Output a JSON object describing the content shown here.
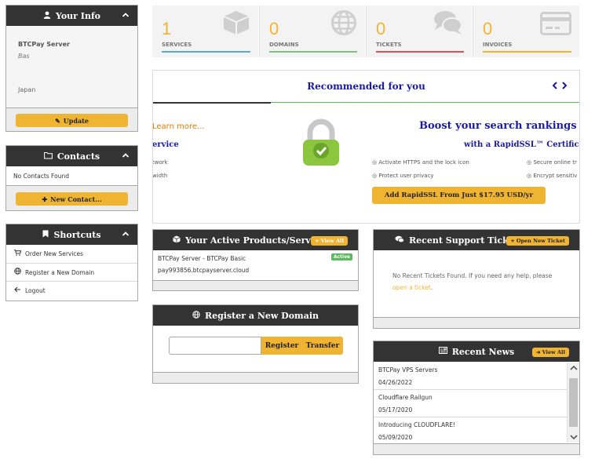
{
  "your_info": {
    "title": "Your Info",
    "name": "BTCPay Server",
    "subtitle": "Bas",
    "country": "Japan",
    "update_label": "Update"
  },
  "contacts": {
    "title": "Contacts",
    "empty_text": "No Contacts Found",
    "new_label": "New Contact..."
  },
  "shortcuts": {
    "title": "Shortcuts",
    "items": [
      {
        "label": "Order New Services",
        "icon": "cart-icon"
      },
      {
        "label": "Register a New Domain",
        "icon": "globe-icon"
      },
      {
        "label": "Logout",
        "icon": "arrow-left-icon"
      }
    ]
  },
  "stats": [
    {
      "value": "1",
      "label": "SERVICES",
      "color": "#5aa7d8",
      "icon": "box-icon"
    },
    {
      "value": "0",
      "label": "DOMAINS",
      "color": "#7cc47a",
      "icon": "globe-icon"
    },
    {
      "value": "0",
      "label": "TICKETS",
      "color": "#d9534f",
      "icon": "comments-icon"
    },
    {
      "value": "0",
      "label": "INVOICES",
      "color": "#f0b433",
      "icon": "credit-card-icon"
    }
  ],
  "recommended": {
    "title": "Recommended for you",
    "learn_more": "Learn more...",
    "left_heading": "ervice",
    "left_line1": "twork",
    "left_line2": "width",
    "headline": "Boost your search rankings",
    "subheadline": "with a RapidSSL™ Certifica",
    "features": [
      "Activate HTTPS and the lock icon",
      "Protect user privacy",
      "Secure online tr",
      "Encrypt sensitiv"
    ],
    "cta": "Add RapidSSL From Just $17.95 USD/yr"
  },
  "active_products": {
    "title": "Your Active Products/Services",
    "view_all": "View All",
    "product_name": "BTCPay Server - BTCPay Basic",
    "product_domain": "pay993856.btcpayserver.cloud",
    "status": "Active"
  },
  "support": {
    "title": "Recent Support Tickets",
    "open_ticket": "Open New Ticket",
    "message": "No Recent Tickets Found. If you need any help, please",
    "link1": "open",
    "link2": "a ticket",
    "period": "."
  },
  "register_domain": {
    "title": "Register a New Domain",
    "input_value": "",
    "register_label": "Register",
    "transfer_label": "Transfer"
  },
  "news": {
    "title": "Recent News",
    "view_all": "View All",
    "items": [
      {
        "title": "BTCPay VPS Servers",
        "date": "04/26/2022"
      },
      {
        "title": "Cloudflare Railgun",
        "date": "05/17/2020"
      },
      {
        "title": "Introducing CLOUDFLARE!",
        "date": "05/09/2020"
      }
    ]
  },
  "colors": {
    "accent": "#f0b433",
    "header_dark": "#333333",
    "link_blue": "#1a1aa6",
    "learn_orange": "#e07b00",
    "green": "#5cb85c"
  }
}
